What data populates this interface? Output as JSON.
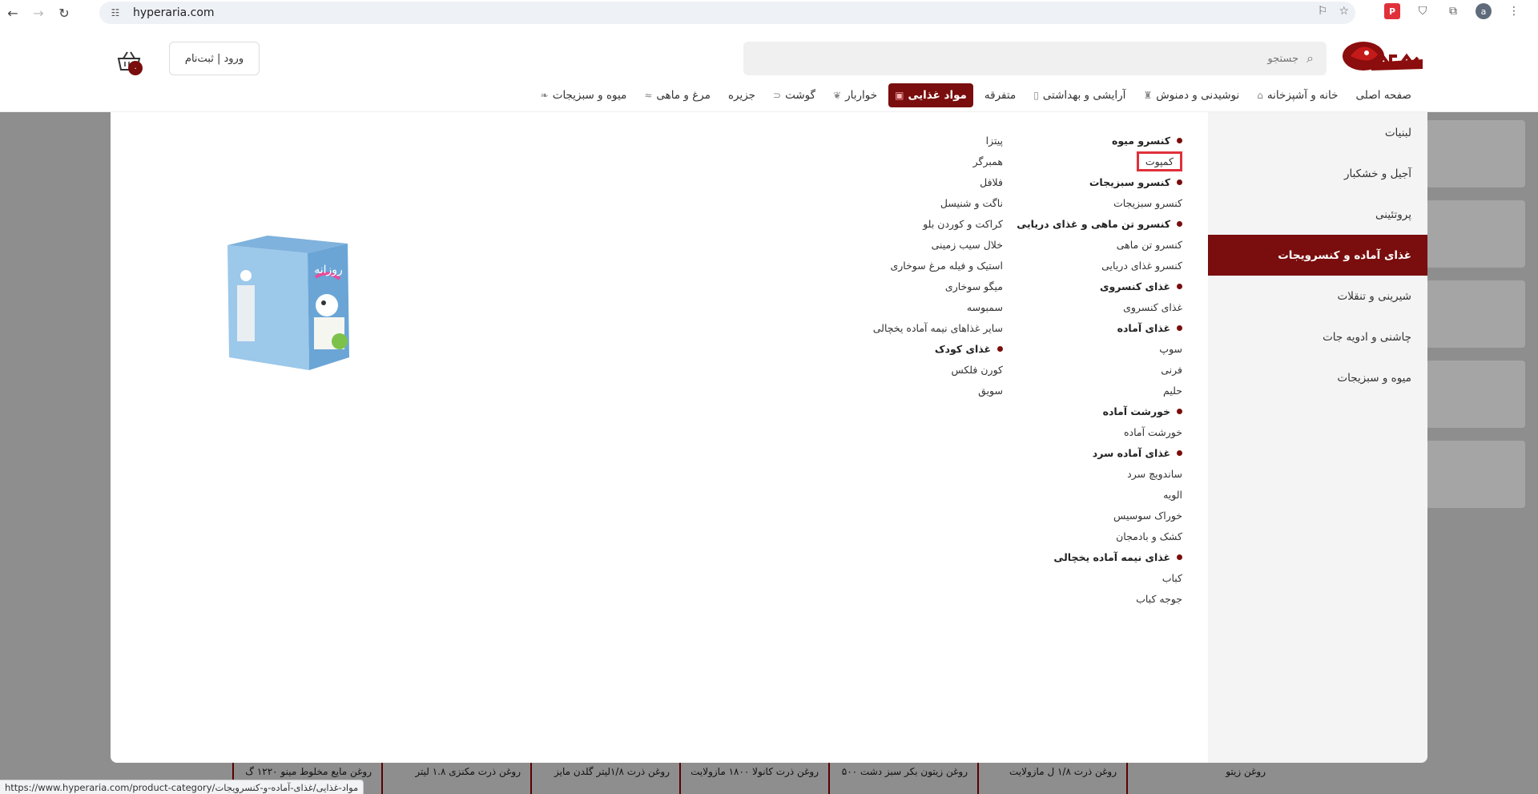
{
  "browser": {
    "url": "hyperaria.com",
    "status_url": "https://www.hyperaria.com/product-category/مواد-غذایی/غذای-آماده-و-کنسرویجات",
    "avatar_letter": "a"
  },
  "header": {
    "search_placeholder": "جستجو",
    "login_label": "ورود | ثبت‌نام",
    "cart_count": "۰"
  },
  "nav": {
    "items": [
      {
        "label": "صفحه اصلی",
        "icon": "",
        "active": false
      },
      {
        "label": "خانه و آشپزخانه",
        "icon": "⌂",
        "active": false
      },
      {
        "label": "نوشیدنی و دمنوش",
        "icon": "♜",
        "active": false
      },
      {
        "label": "آرایشی و بهداشتی",
        "icon": "▯",
        "active": false
      },
      {
        "label": "متفرقه",
        "icon": "",
        "active": false
      },
      {
        "label": "مواد غذایی",
        "icon": "▣",
        "active": true
      },
      {
        "label": "خواربار",
        "icon": "❦",
        "active": false
      },
      {
        "label": "گوشت",
        "icon": "⊂",
        "active": false
      },
      {
        "label": "جزیره",
        "icon": "",
        "active": false
      },
      {
        "label": "مرغ و ماهی",
        "icon": "≈",
        "active": false
      },
      {
        "label": "میوه و سبزیجات",
        "icon": "❧",
        "active": false
      }
    ]
  },
  "mega_side": {
    "items": [
      {
        "label": "لبنیات",
        "active": false
      },
      {
        "label": "آجیل و خشکبار",
        "active": false
      },
      {
        "label": "پروتئینی",
        "active": false
      },
      {
        "label": "غذای آماده و کنسرویجات",
        "active": true
      },
      {
        "label": "شیرینی و تنقلات",
        "active": false
      },
      {
        "label": "چاشنی و ادویه جات",
        "active": false
      },
      {
        "label": "میوه و سبزیجات",
        "active": false
      }
    ]
  },
  "mega_col1": [
    {
      "label": "کنسرو میوه",
      "head": true
    },
    {
      "label": "کمپوت",
      "head": false,
      "highlight": true
    },
    {
      "label": "کنسرو سبزیجات",
      "head": true
    },
    {
      "label": "کنسرو سبزیجات",
      "head": false
    },
    {
      "label": "کنسرو تن ماهی و غذای دریایی",
      "head": true
    },
    {
      "label": "کنسرو تن ماهی",
      "head": false
    },
    {
      "label": "کنسرو غذای دریایی",
      "head": false
    },
    {
      "label": "غذای کنسروی",
      "head": true
    },
    {
      "label": "غذای کنسروی",
      "head": false
    },
    {
      "label": "غذای آماده",
      "head": true
    },
    {
      "label": "سوپ",
      "head": false
    },
    {
      "label": "فرنی",
      "head": false
    },
    {
      "label": "حلیم",
      "head": false
    },
    {
      "label": "خورشت آماده",
      "head": true
    },
    {
      "label": "خورشت آماده",
      "head": false
    },
    {
      "label": "غذای آماده سرد",
      "head": true
    },
    {
      "label": "ساندویچ سرد",
      "head": false
    },
    {
      "label": "الویه",
      "head": false
    },
    {
      "label": "خوراک سوسیس",
      "head": false
    },
    {
      "label": "کشک و بادمجان",
      "head": false
    },
    {
      "label": "غذای نیمه آماده یخچالی",
      "head": true
    },
    {
      "label": "کباب",
      "head": false
    },
    {
      "label": "جوجه کباب",
      "head": false
    }
  ],
  "mega_col2": [
    {
      "label": "پیتزا",
      "head": false
    },
    {
      "label": "همبرگر",
      "head": false
    },
    {
      "label": "فلافل",
      "head": false
    },
    {
      "label": "ناگت و شنیسل",
      "head": false
    },
    {
      "label": "کراکت و کوردن بلو",
      "head": false
    },
    {
      "label": "خلال سیب زمینی",
      "head": false
    },
    {
      "label": "استیک و فیله مرغ سوخاری",
      "head": false
    },
    {
      "label": "میگو سوخاری",
      "head": false
    },
    {
      "label": "سمبوسه",
      "head": false
    },
    {
      "label": "سایر غذاهای نیمه آماده یخچالی",
      "head": false
    },
    {
      "label": "غذای کودک",
      "head": true
    },
    {
      "label": "کورن فلکس",
      "head": false
    },
    {
      "label": "سویق",
      "head": false
    }
  ],
  "promo": {
    "brand_text": "روزانه"
  },
  "bg_products": [
    "روغن مایع مخلوط مینو ۱۲۲۰ گ",
    "روغن ذرت مکنزی ۱.۸ لیتر",
    "روغن ذرت ۱/۸لیتر گلدن مایز",
    "روغن ذرت کانولا ۱۸۰۰ مازولایت",
    "روغن زیتون بکر سبز دشت ۵۰۰",
    "روغن ذرت ۱/۸ ل مازولایت",
    "روغن زیتو"
  ]
}
